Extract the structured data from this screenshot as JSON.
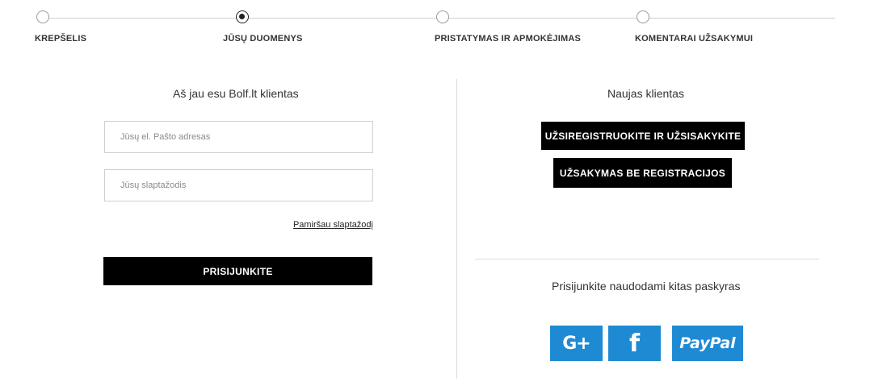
{
  "steps": [
    {
      "label": "KREPŠELIS",
      "active": false
    },
    {
      "label": "JŪSŲ DUOMENYS",
      "active": true
    },
    {
      "label": "PRISTATYMAS IR APMOKĖJIMAS",
      "active": false
    },
    {
      "label": "KOMENTARAI UŽSAKYMUI",
      "active": false
    }
  ],
  "login": {
    "heading": "Aš jau esu Bolf.lt klientas",
    "email_placeholder": "Jūsų el. Pašto adresas",
    "password_placeholder": "Jūsų slaptažodis",
    "forgot_label": "Pamiršau slaptažodį",
    "submit_label": "PRISIJUNKITE"
  },
  "new_customer": {
    "heading": "Naujas klientas",
    "register_label": "UŽSIREGISTRUOKITE IR UŽSISAKYKITE",
    "guest_label": "UŽSAKYMAS BE REGISTRACIJOS"
  },
  "social": {
    "heading": "Prisijunkite naudodami kitas paskyras",
    "buttons": [
      {
        "icon": "google-plus-icon",
        "text": "G+"
      },
      {
        "icon": "facebook-icon",
        "text": "f"
      },
      {
        "icon": "paypal-icon",
        "text": "PayPal"
      }
    ],
    "color": "#1f8ad4"
  }
}
